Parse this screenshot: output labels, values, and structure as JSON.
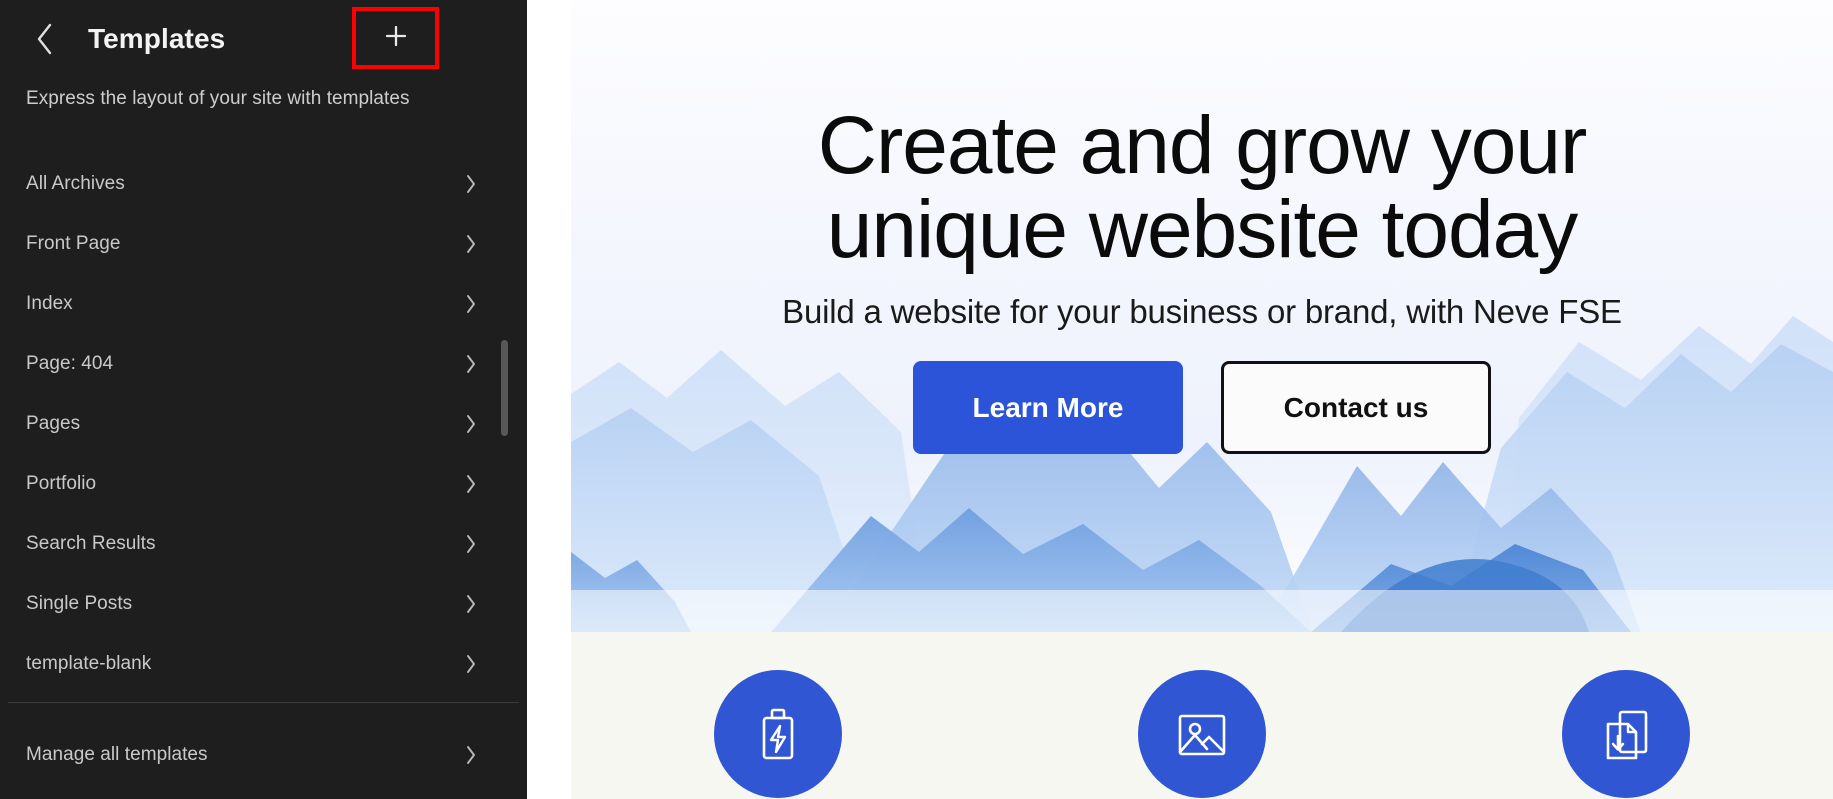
{
  "sidebar": {
    "back_icon": "chevron-left-icon",
    "title": "Templates",
    "add_button_icon": "plus-icon",
    "add_button_label": "+",
    "subtitle": "Express the layout of your site with templates",
    "items": [
      {
        "label": "All Archives",
        "chevron": "chevron-right-icon"
      },
      {
        "label": "Front Page",
        "chevron": "chevron-right-icon"
      },
      {
        "label": "Index",
        "chevron": "chevron-right-icon"
      },
      {
        "label": "Page: 404",
        "chevron": "chevron-right-icon"
      },
      {
        "label": "Pages",
        "chevron": "chevron-right-icon"
      },
      {
        "label": "Portfolio",
        "chevron": "chevron-right-icon"
      },
      {
        "label": "Search Results",
        "chevron": "chevron-right-icon"
      },
      {
        "label": "Single Posts",
        "chevron": "chevron-right-icon"
      },
      {
        "label": "template-blank",
        "chevron": "chevron-right-icon"
      }
    ],
    "footer_item": {
      "label": "Manage all templates",
      "chevron": "chevron-right-icon"
    },
    "scrollbar": {
      "name": "sidebar-scrollbar"
    },
    "colors": {
      "background": "#1e1e1e",
      "text": "#c9c9c9",
      "title": "#f3f3f3",
      "highlight_box": "#ff0000"
    }
  },
  "preview": {
    "hero": {
      "title_line_1": "Create and grow your",
      "title_line_2": "unique website today",
      "subtitle": "Build a website for your business or brand, with Neve FSE",
      "primary_button": "Learn More",
      "secondary_button": "Contact us",
      "background_art": "mountain-landscape"
    },
    "features": [
      {
        "icon": "battery-charging-icon"
      },
      {
        "icon": "image-icon"
      },
      {
        "icon": "document-download-icon"
      }
    ],
    "colors": {
      "primary": "#2b54d9",
      "feature_circle": "#3056d3",
      "features_background": "#f7f7f2",
      "hero_text": "#0b0b0b"
    }
  }
}
